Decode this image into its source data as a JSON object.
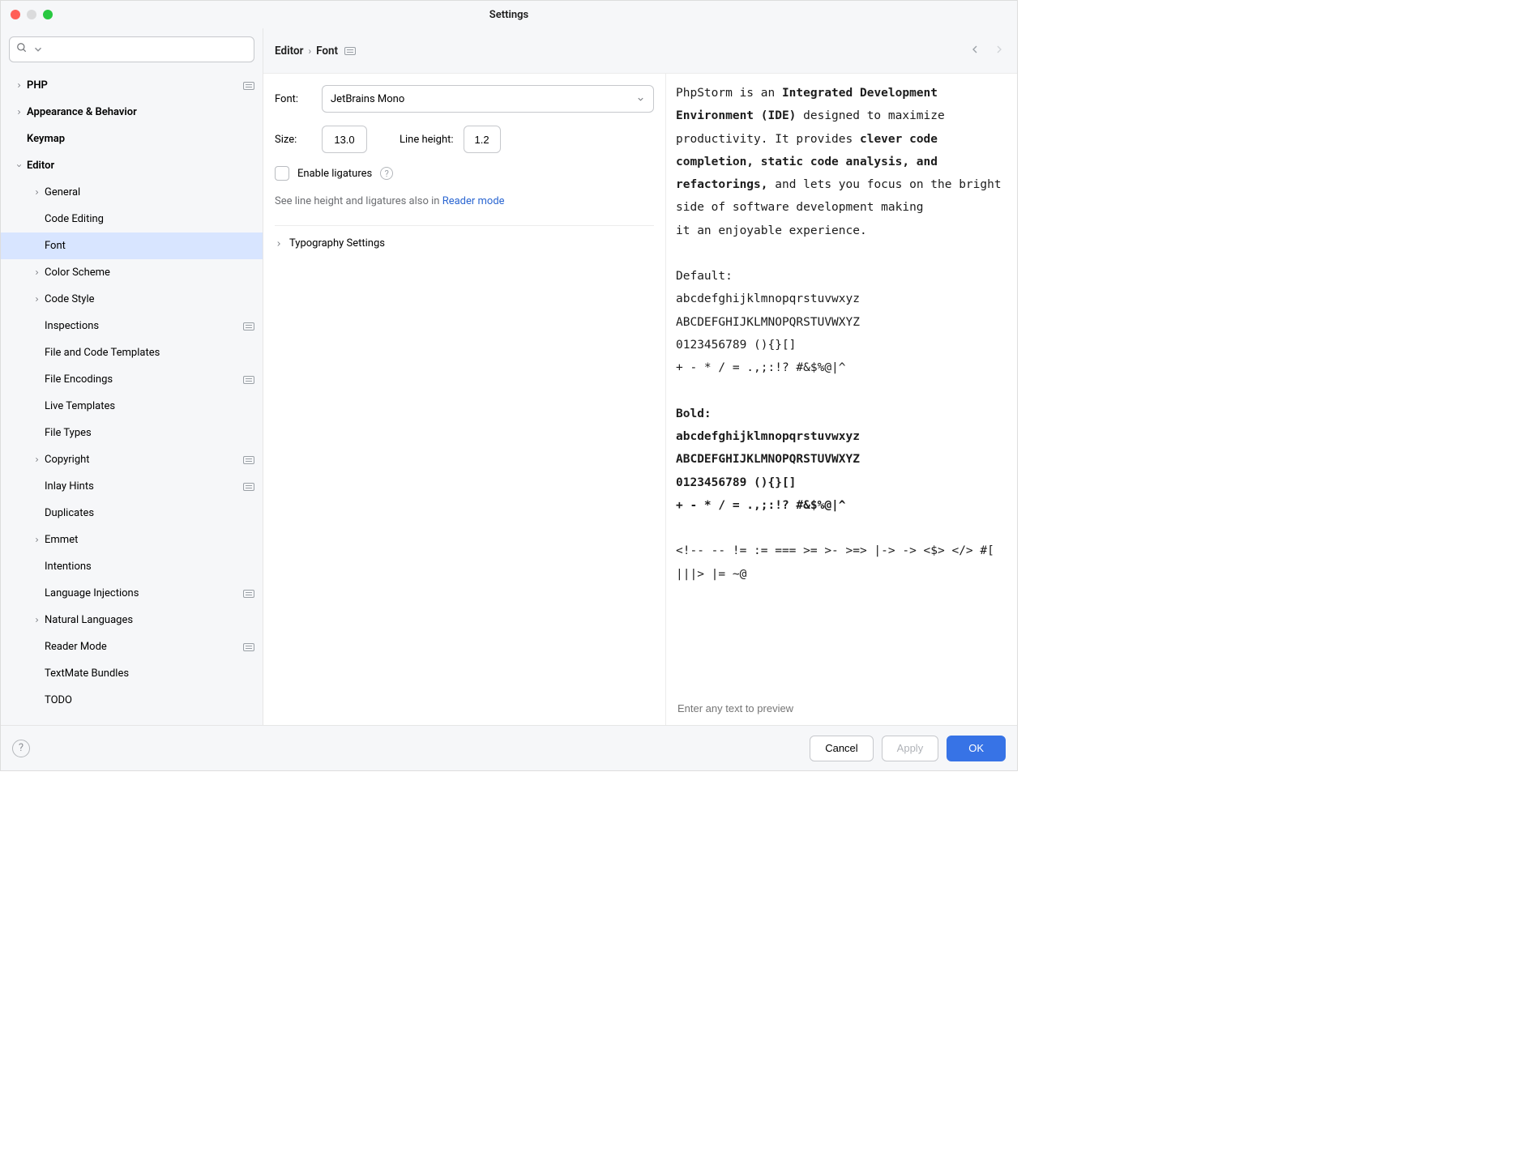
{
  "window_title": "Settings",
  "breadcrumb": {
    "a": "Editor",
    "b": "Font"
  },
  "sidebar": {
    "items": [
      {
        "label": "PHP",
        "depth": 0,
        "bold": true,
        "chevron": "right",
        "badge": true
      },
      {
        "label": "Appearance & Behavior",
        "depth": 0,
        "bold": true,
        "chevron": "right"
      },
      {
        "label": "Keymap",
        "depth": 0,
        "bold": true
      },
      {
        "label": "Editor",
        "depth": 0,
        "bold": true,
        "chevron": "down"
      },
      {
        "label": "General",
        "depth": 1,
        "chevron": "right"
      },
      {
        "label": "Code Editing",
        "depth": 1
      },
      {
        "label": "Font",
        "depth": 1,
        "selected": true
      },
      {
        "label": "Color Scheme",
        "depth": 1,
        "chevron": "right"
      },
      {
        "label": "Code Style",
        "depth": 1,
        "chevron": "right"
      },
      {
        "label": "Inspections",
        "depth": 1,
        "badge": true
      },
      {
        "label": "File and Code Templates",
        "depth": 1
      },
      {
        "label": "File Encodings",
        "depth": 1,
        "badge": true
      },
      {
        "label": "Live Templates",
        "depth": 1
      },
      {
        "label": "File Types",
        "depth": 1
      },
      {
        "label": "Copyright",
        "depth": 1,
        "chevron": "right",
        "badge": true
      },
      {
        "label": "Inlay Hints",
        "depth": 1,
        "badge": true
      },
      {
        "label": "Duplicates",
        "depth": 1
      },
      {
        "label": "Emmet",
        "depth": 1,
        "chevron": "right"
      },
      {
        "label": "Intentions",
        "depth": 1
      },
      {
        "label": "Language Injections",
        "depth": 1,
        "badge": true
      },
      {
        "label": "Natural Languages",
        "depth": 1,
        "chevron": "right"
      },
      {
        "label": "Reader Mode",
        "depth": 1,
        "badge": true
      },
      {
        "label": "TextMate Bundles",
        "depth": 1
      },
      {
        "label": "TODO",
        "depth": 1
      }
    ]
  },
  "form": {
    "font_label": "Font:",
    "font_value": "JetBrains Mono",
    "size_label": "Size:",
    "size_value": "13.0",
    "lineheight_label": "Line height:",
    "lineheight_value": "1.2",
    "ligatures_label": "Enable ligatures",
    "hint_prefix": "See line height and ligatures also in ",
    "hint_link": "Reader mode",
    "typography_label": "Typography Settings"
  },
  "preview": {
    "placeholder": "Enter any text to preview",
    "para_1a": "PhpStorm is an ",
    "para_1b": "Integrated Development Environment (IDE)",
    "para_1c": " designed to maximize productivity. It provides ",
    "para_1d": "clever code completion, static code analysis, and refactorings,",
    "para_1e": " and lets you focus on the bright side of software development making",
    "para_1f": "it an enjoyable experience.",
    "default_hdr": "Default:",
    "bold_hdr": "Bold:",
    "sample_lc": "abcdefghijklmnopqrstuvwxyz",
    "sample_uc": "ABCDEFGHIJKLMNOPQRSTUVWXYZ",
    "sample_num": "0123456789 (){}[]",
    "sample_sym": "+ - * / = .,;:!? #&$%@|^",
    "ligatures": "<!-- -- != := === >= >- >=> |-> -> <$> </> #[ |||> |= ~@"
  },
  "footer": {
    "cancel": "Cancel",
    "apply": "Apply",
    "ok": "OK"
  }
}
